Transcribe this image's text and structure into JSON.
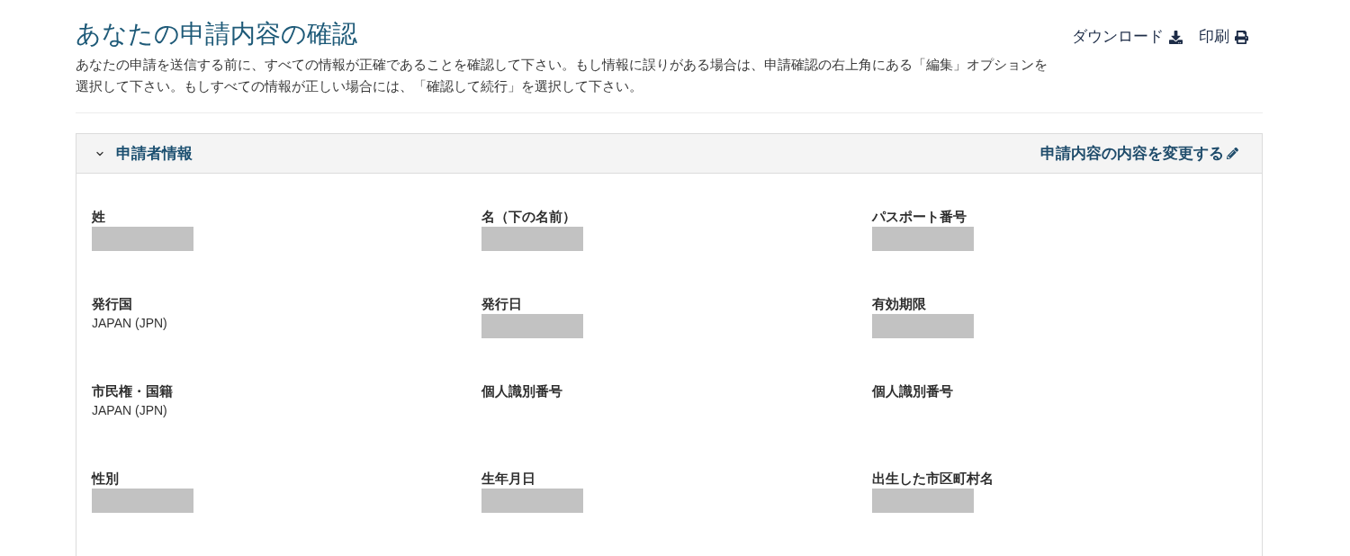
{
  "page": {
    "title": "あなたの申請内容の確認",
    "description": "あなたの申請を送信する前に、すべての情報が正確であることを確認して下さい。もし情報に誤りがある場合は、申請確認の右上角にある「編集」オプションを選択して下さい。もしすべての情報が正しい場合には、「確認して続行」を選択して下さい。",
    "actions": [
      {
        "label": "ダウンロード",
        "kind": "download"
      },
      {
        "label": "印刷",
        "kind": "print"
      }
    ]
  },
  "section": {
    "title": "申請者情報",
    "expanded": true,
    "edit_link": "申請内容の内容を変更する",
    "fields": [
      {
        "label": "姓",
        "kind": "redacted"
      },
      {
        "label": "名（下の名前）",
        "kind": "redacted"
      },
      {
        "label": "パスポート番号",
        "kind": "redacted"
      },
      {
        "label": "発行国",
        "kind": "text",
        "value": "JAPAN (JPN)"
      },
      {
        "label": "発行日",
        "kind": "redacted"
      },
      {
        "label": "有効期限",
        "kind": "redacted"
      },
      {
        "label": "市民権・国籍",
        "kind": "text",
        "value": "JAPAN (JPN)"
      },
      {
        "label": "個人識別番号",
        "kind": "empty"
      },
      {
        "label": "個人識別番号",
        "kind": "empty"
      },
      {
        "label": "性別",
        "kind": "redacted"
      },
      {
        "label": "生年月日",
        "kind": "redacted"
      },
      {
        "label": "出生した市区町村名",
        "kind": "redacted"
      }
    ]
  }
}
